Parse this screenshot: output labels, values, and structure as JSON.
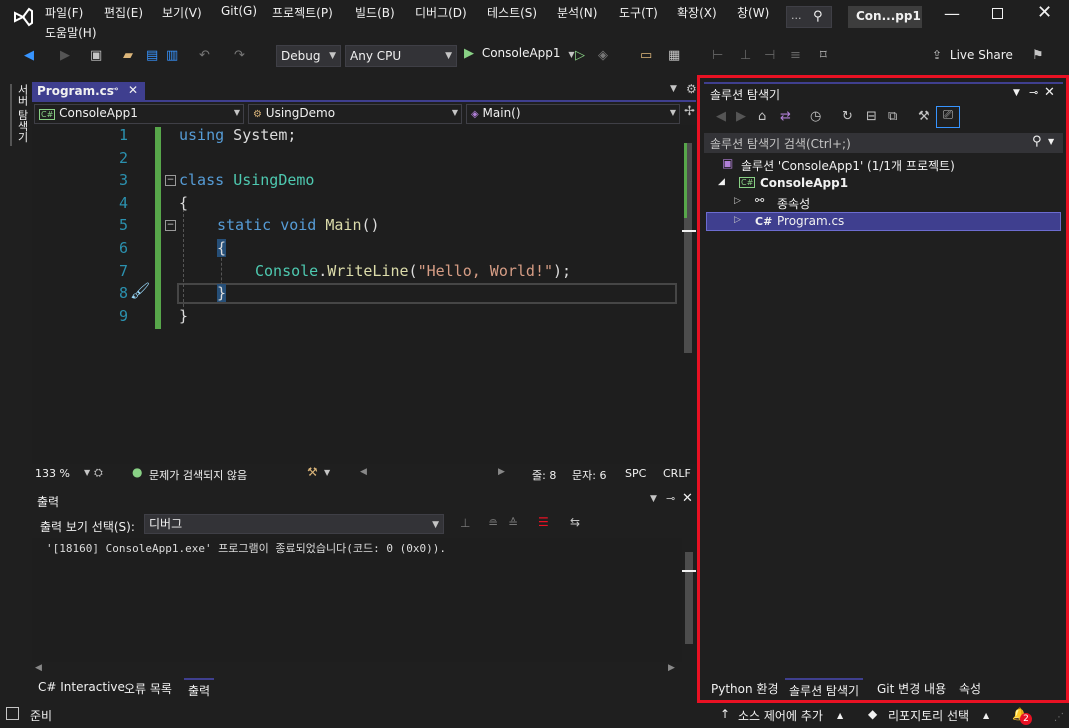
{
  "menu": {
    "items": [
      "파일(F)",
      "편집(E)",
      "보기(V)",
      "Git(G)",
      "프로젝트(P)",
      "빌드(B)",
      "디버그(D)",
      "테스트(S)",
      "분석(N)",
      "도구(T)",
      "확장(X)",
      "창(W)"
    ],
    "help": "도움말(H)",
    "search_dots": "...",
    "window_title": "Con...pp1"
  },
  "toolbar": {
    "config": "Debug",
    "platform": "Any CPU",
    "run_label": "ConsoleApp1",
    "live_share": "Live Share"
  },
  "left_strip": {
    "label": "서버 탐색기"
  },
  "editor": {
    "tab_name": "Program.cs",
    "nav_project": "ConsoleApp1",
    "nav_class": "UsingDemo",
    "nav_member": "Main()",
    "line_numbers": [
      "1",
      "2",
      "3",
      "4",
      "5",
      "6",
      "7",
      "8",
      "9"
    ],
    "code": {
      "l1_kw": "using",
      "l1_rest": " System;",
      "l3_kw": "class",
      "l3_name": "UsingDemo",
      "l4": "{",
      "l5_kw1": "static",
      "l5_kw2": "void",
      "l5_fn": "Main",
      "l5_rest": "()",
      "l6": "{",
      "l7_type": "Console",
      "l7_dot": ".",
      "l7_fn": "WriteLine",
      "l7_open": "(",
      "l7_str": "\"Hello, World!\"",
      "l7_close": ");",
      "l8": "}",
      "l9": "}"
    },
    "status": {
      "zoom": "133 %",
      "issues": "문제가 검색되지 않음",
      "line": "줄: 8",
      "col": "문자: 6",
      "spc": "SPC",
      "crlf": "CRLF"
    }
  },
  "output": {
    "title": "출력",
    "source_label": "출력 보기 선택(S):",
    "source_value": "디버그",
    "text": "'[18160] ConsoleApp1.exe' 프로그램이 종료되었습니다(코드: 0 (0x0)).",
    "tabs": [
      "C# Interactive",
      "오류 목록",
      "출력"
    ]
  },
  "solution_explorer": {
    "title": "솔루션 탐색기",
    "search_placeholder": "솔루션 탐색기 검색(Ctrl+;)",
    "solution": "솔루션 'ConsoleApp1' (1/1개 프로젝트)",
    "project": "ConsoleApp1",
    "dependencies": "종속성",
    "file": "Program.cs",
    "cs_badge": "C#",
    "tabs": [
      "Python 환경",
      "솔루션 탐색기",
      "Git 변경 내용",
      "속성"
    ]
  },
  "statusbar": {
    "ready": "준비",
    "source_control": "소스 제어에 추가",
    "repo": "리포지토리 선택",
    "notifications": "2"
  },
  "colors": {
    "accent_purple": "#3f3f8f",
    "highlight_red": "#e81123",
    "keyword": "#569cd6",
    "type": "#4ec9b0",
    "string": "#d69d85",
    "line_number": "#2b91af"
  }
}
